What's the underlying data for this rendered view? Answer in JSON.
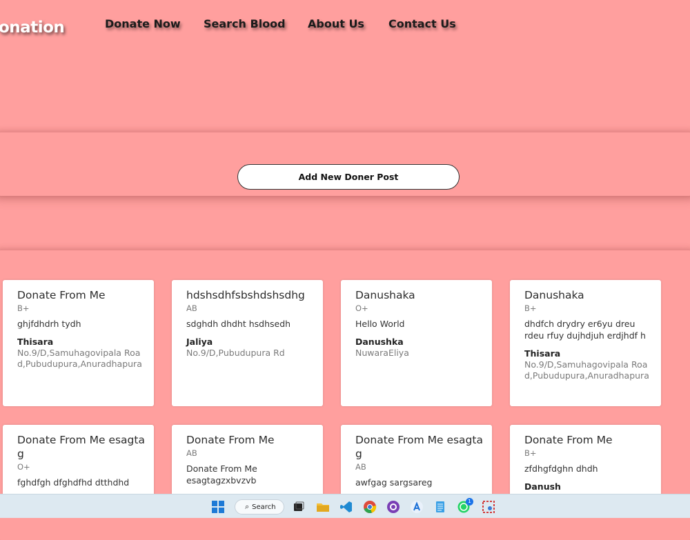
{
  "nav": {
    "logo": "onation",
    "links": [
      "Donate Now",
      "Search Blood",
      "About Us",
      "Contact Us"
    ]
  },
  "actions": {
    "add_post": "Add New Doner Post"
  },
  "posts": [
    {
      "title": "Donate From Me",
      "group": "B+",
      "desc": "ghjfdhdrh tydh",
      "name": "Thisara",
      "address": "No.9/D,Samuhagovipala Road,Pubudupura,Anuradhapura"
    },
    {
      "title": "hdshsdhfsbshdshsdhg",
      "group": "AB",
      "desc": "sdghdh dhdht hsdhsedh",
      "name": "Jaliya",
      "address": "No.9/D,Pubudupura Rd"
    },
    {
      "title": "Danushaka",
      "group": "O+",
      "desc": "Hello World",
      "name": "Danushka",
      "address": "NuwaraEliya"
    },
    {
      "title": "Danushaka",
      "group": "B+",
      "desc": "dhdfch drydry er6yu dreu rdeu rfuy dujhdjuh erdjhdf h",
      "name": "Thisara",
      "address": "No.9/D,Samuhagovipala Road,Pubudupura,Anuradhapura"
    },
    {
      "title": "Donate From Me esagtag",
      "group": "O+",
      "desc": "fghdfgh dfghdfhd dtthdhd"
    },
    {
      "title": "Donate From Me",
      "group": "AB",
      "desc": "Donate From Me esagtagzxbvzvb"
    },
    {
      "title": "Donate From Me esagtag",
      "group": "AB",
      "desc": "awfgag sargsareg"
    },
    {
      "title": "Donate From Me",
      "group": "B+",
      "desc": "zfdhgfdghn dhdh",
      "name": "Danush"
    }
  ],
  "taskbar": {
    "search_label": "Search",
    "whatsapp_badge": "1"
  }
}
